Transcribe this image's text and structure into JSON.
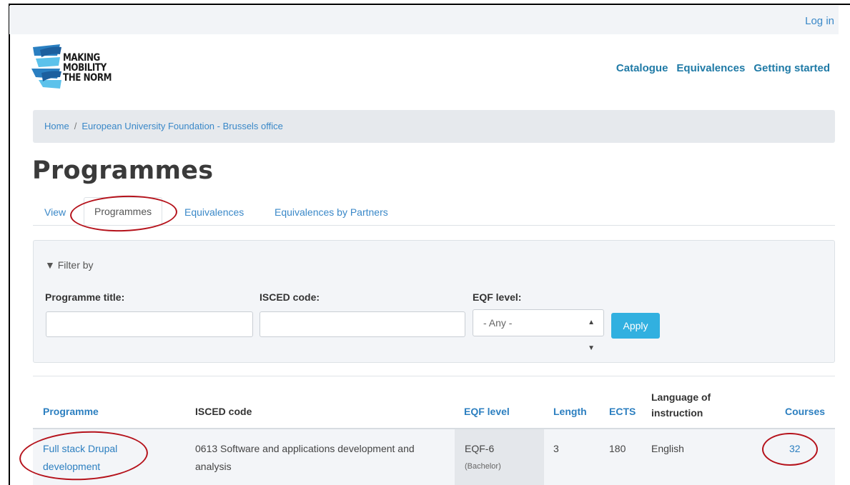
{
  "header": {
    "login_label": "Log in",
    "logo": {
      "alt": "Making Mobility The Norm logo",
      "lines": [
        "MAKING",
        "MOBILITY",
        "THE NORM"
      ]
    },
    "nav": [
      "Catalogue",
      "Equivalences",
      "Getting started"
    ]
  },
  "breadcrumb": {
    "items": [
      "Home",
      "European University Foundation - Brussels office"
    ],
    "separator": "/"
  },
  "page_title": "Programmes",
  "tabs": [
    {
      "label": "View",
      "active": false
    },
    {
      "label": "Programmes",
      "active": true
    },
    {
      "label": "Equivalences",
      "active": false
    },
    {
      "label": "Equivalences by Partners",
      "active": false
    }
  ],
  "filter": {
    "toggle_label": "▼ Filter by",
    "fields": [
      {
        "label": "Programme title:",
        "value": "",
        "placeholder": ""
      },
      {
        "label": "ISCED code:",
        "value": "",
        "placeholder": ""
      },
      {
        "label": "EQF level:",
        "selected": "- Any -"
      }
    ],
    "apply_label": "Apply"
  },
  "table": {
    "headers": [
      {
        "label": "Programme",
        "sortable": true
      },
      {
        "label": "ISCED code",
        "sortable": false
      },
      {
        "label": "EQF level",
        "sortable": true
      },
      {
        "label": "Length",
        "sortable": true
      },
      {
        "label": "ECTS",
        "sortable": true
      },
      {
        "label": "Language of instruction",
        "sortable": false
      },
      {
        "label": "Courses",
        "sortable": true
      }
    ],
    "rows": [
      {
        "programme": "Full stack Drupal development",
        "isced": "0613 Software and applications development and analysis",
        "eqf": "EQF-6",
        "eqf_note": "(Bachelor)",
        "length": "3",
        "ects": "180",
        "language": "English",
        "courses": "32"
      }
    ]
  },
  "colors": {
    "link": "#2c7fc0",
    "nav": "#1f7aa6",
    "apply": "#31b0e0",
    "annotation": "#b5121b",
    "logo_blue": "#2a7fc1",
    "logo_light": "#5cc2eb"
  }
}
